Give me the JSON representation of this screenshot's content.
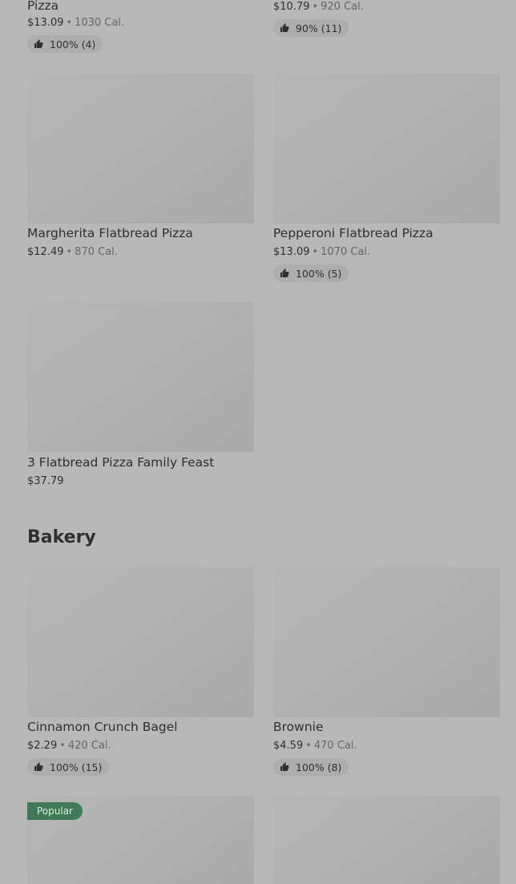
{
  "items": {
    "pizza_top_left": {
      "title": "Pizza",
      "price": "$13.09",
      "calories": "1030 Cal.",
      "rating": "100% (4)"
    },
    "pizza_top_right": {
      "price": "$10.79",
      "calories": "920 Cal.",
      "rating": "90% (11)"
    },
    "margherita": {
      "title": "Margherita Flatbread Pizza",
      "price": "$12.49",
      "calories": "870 Cal."
    },
    "pepperoni": {
      "title": "Pepperoni Flatbread Pizza",
      "price": "$13.09",
      "calories": "1070 Cal.",
      "rating": "100% (5)"
    },
    "family_feast": {
      "title": "3 Flatbread Pizza Family Feast",
      "price": "$37.79"
    },
    "bagel": {
      "title": "Cinnamon Crunch Bagel",
      "price": "$2.29",
      "calories": "420 Cal.",
      "rating": "100% (15)"
    },
    "brownie": {
      "title": "Brownie",
      "price": "$4.59",
      "calories": "470 Cal.",
      "rating": "100% (8)"
    },
    "bakery_bottom_left": {
      "badge": "Popular"
    }
  },
  "sections": {
    "bakery_title": "Bakery"
  },
  "separator": "•",
  "colors": {
    "background": "#b8b8b8",
    "badge": "#3f7a57",
    "rating_pill": "#adadad"
  },
  "icons": {
    "rating": "thumbs-up-icon"
  }
}
